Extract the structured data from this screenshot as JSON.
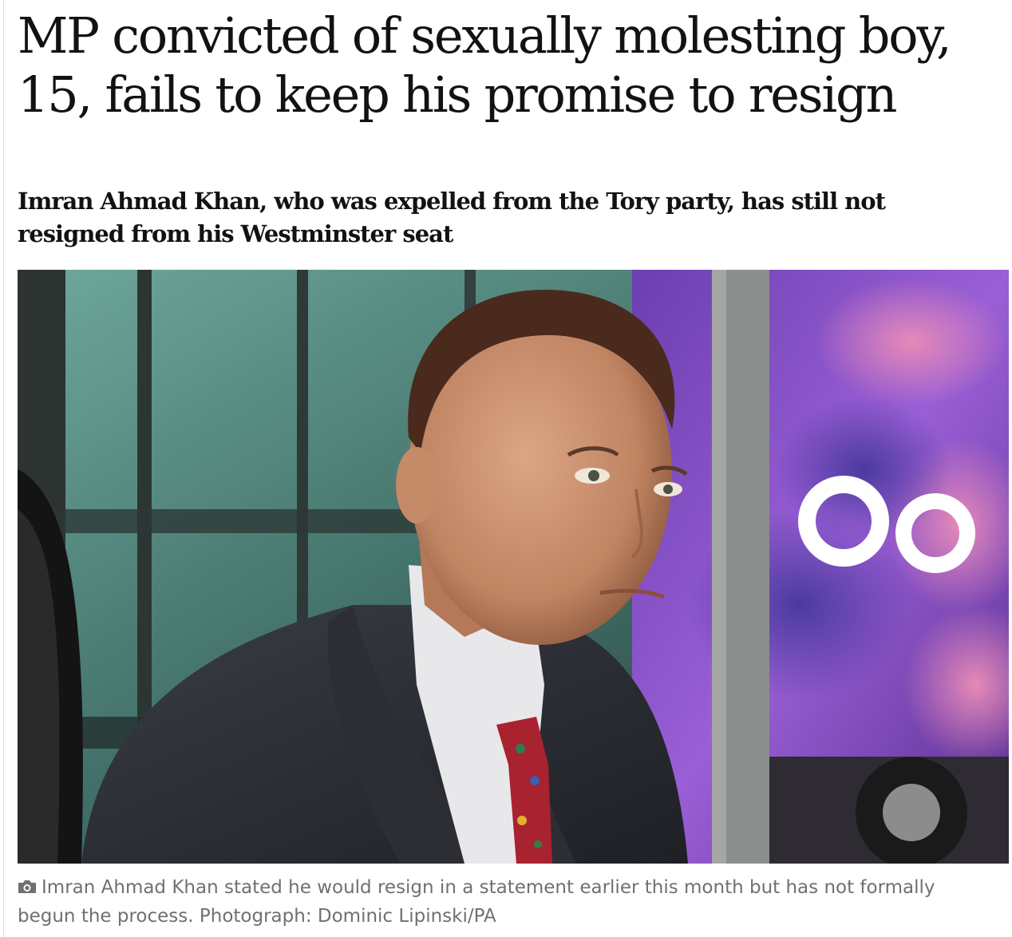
{
  "article": {
    "headline": "MP convicted of sexually molesting boy, 15, fails to keep his promise to resign",
    "standfirst": "Imran Ahmad Khan, who was expelled from the Tory party, has still not resigned from his Westminster seat",
    "image": {
      "caption": "Imran Ahmad Khan stated he would resign in a statement earlier this month but has not formally begun the process.",
      "credit": "Photograph: Dominic Lipinski/PA",
      "caption_icon": "camera-icon"
    }
  },
  "colors": {
    "text": "#121212",
    "caption": "#707070"
  }
}
